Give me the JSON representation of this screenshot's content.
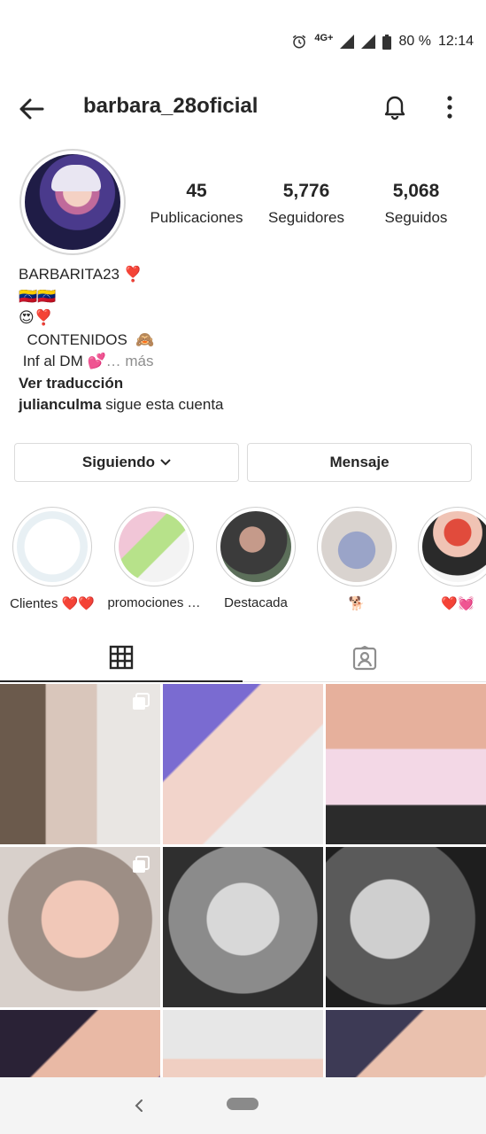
{
  "status_bar": {
    "network": "4G+",
    "battery": "80 %",
    "time": "12:14",
    "icons": [
      "alarm-icon",
      "signal-icon",
      "signal-icon",
      "battery-icon"
    ]
  },
  "header": {
    "username": "barbara_28oficial",
    "back_icon": "arrow-left-icon",
    "bell_icon": "bell-icon",
    "more_icon": "more-vertical-icon"
  },
  "profile": {
    "stats": [
      {
        "value": "45",
        "label": "Publicaciones"
      },
      {
        "value": "5,776",
        "label": "Seguidores"
      },
      {
        "value": "5,068",
        "label": "Seguidos"
      }
    ],
    "bio": {
      "name_line": "BARBARITA23 ❣️",
      "line2": "🇻🇪🇻🇪",
      "line3": "😍❣️",
      "line4": "  CONTENIDOS  🙈",
      "line5": " Inf al DM 💕",
      "more": "… más",
      "translate": "Ver traducción",
      "follower_user": "julianculma",
      "follower_text": " sigue esta cuenta"
    }
  },
  "buttons": {
    "following": "Siguiendo",
    "message": "Mensaje"
  },
  "highlights": [
    {
      "name": "Clientes ❤️❤️"
    },
    {
      "name": "promociones …"
    },
    {
      "name": "Destacada"
    },
    {
      "name": "🐕"
    },
    {
      "name": "❤️💓"
    }
  ],
  "tabs": [
    {
      "icon": "grid-icon",
      "active": true
    },
    {
      "icon": "tagged-person-icon",
      "active": false
    }
  ],
  "colors": {
    "text": "#262626",
    "muted": "#8e8e8e",
    "border": "#dbdbdb",
    "navbar": "#f4f4f4"
  }
}
